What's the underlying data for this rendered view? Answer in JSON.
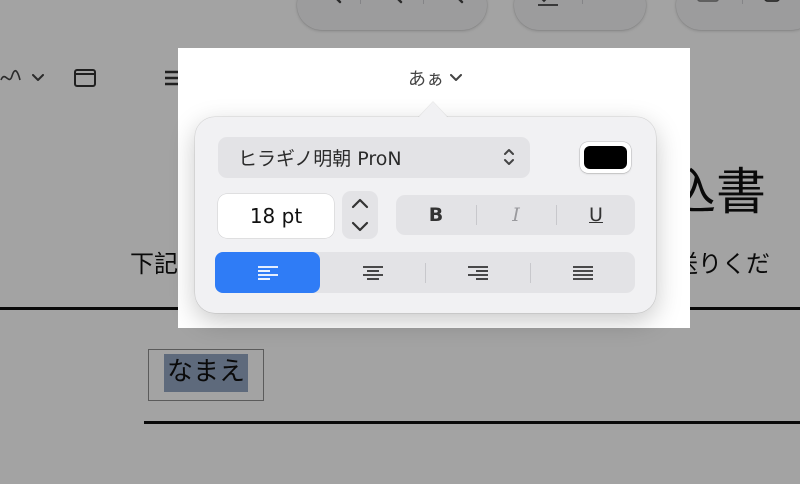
{
  "document": {
    "title_fragment": "込書",
    "instruction_left": "下記の",
    "instruction_right": "へお送りくだ",
    "name_field_value": "なまえ"
  },
  "toolbar": {
    "icons": [
      "zoom-out-icon",
      "zoom-in-icon",
      "zoom-fit-icon",
      "signature-icon",
      "checkmark-icon",
      "image-icon",
      "copy-icon"
    ]
  },
  "markup_bar": {
    "signature_icon": "signature-scribble-icon",
    "window_icon": "window-icon",
    "line_style_icon": "line-style-icon",
    "border_color_icon": "border-color-icon",
    "fill_color_icon": "fill-color-icon",
    "text_style_label": "あぁ"
  },
  "text_style_popover": {
    "font_family": "ヒラギノ明朝 ProN",
    "font_size": "18 pt",
    "text_color": "#000000",
    "bold_label": "B",
    "italic_label": "I",
    "underline_label": "U",
    "alignment_options": [
      "left",
      "center",
      "right",
      "justify"
    ],
    "selected_alignment": "left",
    "accent_color": "#2f7cf6"
  }
}
